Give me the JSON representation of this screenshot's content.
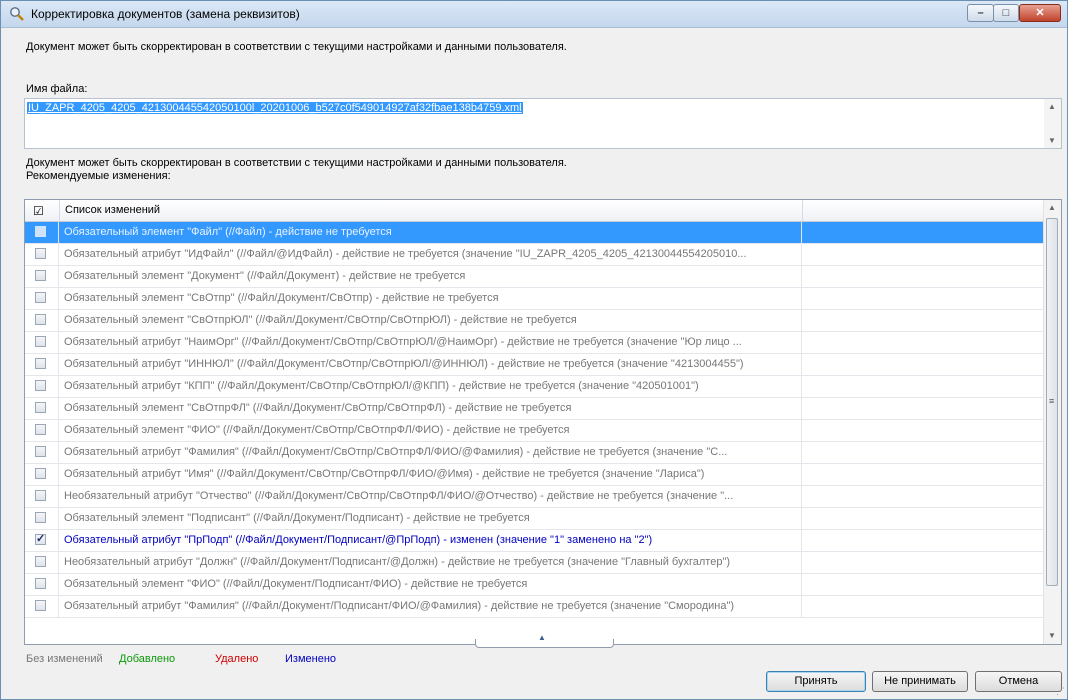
{
  "window": {
    "title": "Корректировка документов (замена реквизитов)",
    "min_label": "–",
    "max_label": "□",
    "close_label": "✕"
  },
  "info_top": "Документ может быть скорректирован в соответствии с текущими настройками и данными пользователя.",
  "file": {
    "label": "Имя файла:",
    "value": "IU_ZAPR_4205_4205_421300445542050100l_20201006_b527c0f549014927af32fbae138b4759.xml"
  },
  "info_mid": {
    "line1": "Документ может быть скорректирован в соответствии с текущими настройками и данными пользователя.",
    "line2": "Рекомендуемые изменения:"
  },
  "list": {
    "header_check": "☑",
    "header_col": "Список изменений",
    "rows": [
      {
        "text": "Обязательный элемент \"Файл\" (//Файл) - действие не требуется",
        "checked": false,
        "selected": true,
        "changed": false
      },
      {
        "text": "Обязательный атрибут \"ИдФайл\" (//Файл/@ИдФайл) - действие не требуется (значение \"IU_ZAPR_4205_4205_42130044554205010...",
        "checked": false,
        "selected": false,
        "changed": false
      },
      {
        "text": "Обязательный элемент \"Документ\" (//Файл/Документ) - действие не требуется",
        "checked": false,
        "selected": false,
        "changed": false
      },
      {
        "text": "Обязательный элемент \"СвОтпр\" (//Файл/Документ/СвОтпр) - действие не требуется",
        "checked": false,
        "selected": false,
        "changed": false
      },
      {
        "text": "Обязательный элемент \"СвОтпрЮЛ\" (//Файл/Документ/СвОтпр/СвОтпрЮЛ) - действие не требуется",
        "checked": false,
        "selected": false,
        "changed": false
      },
      {
        "text": "Обязательный атрибут \"НаимОрг\" (//Файл/Документ/СвОтпр/СвОтпрЮЛ/@НаимОрг) - действие не требуется (значение \"Юр лицо ...",
        "checked": false,
        "selected": false,
        "changed": false
      },
      {
        "text": "Обязательный атрибут \"ИННЮЛ\" (//Файл/Документ/СвОтпр/СвОтпрЮЛ/@ИННЮЛ) - действие не требуется (значение \"4213004455\")",
        "checked": false,
        "selected": false,
        "changed": false
      },
      {
        "text": "Обязательный атрибут \"КПП\" (//Файл/Документ/СвОтпр/СвОтпрЮЛ/@КПП) - действие не требуется (значение \"420501001\")",
        "checked": false,
        "selected": false,
        "changed": false
      },
      {
        "text": "Обязательный элемент \"СвОтпрФЛ\" (//Файл/Документ/СвОтпр/СвОтпрФЛ) - действие не требуется",
        "checked": false,
        "selected": false,
        "changed": false
      },
      {
        "text": "Обязательный элемент \"ФИО\" (//Файл/Документ/СвОтпр/СвОтпрФЛ/ФИО) - действие не требуется",
        "checked": false,
        "selected": false,
        "changed": false
      },
      {
        "text": "Обязательный атрибут \"Фамилия\" (//Файл/Документ/СвОтпр/СвОтпрФЛ/ФИО/@Фамилия) - действие не требуется (значение \"С...",
        "checked": false,
        "selected": false,
        "changed": false
      },
      {
        "text": "Обязательный атрибут \"Имя\" (//Файл/Документ/СвОтпр/СвОтпрФЛ/ФИО/@Имя) - действие не требуется (значение \"Лариса\")",
        "checked": false,
        "selected": false,
        "changed": false
      },
      {
        "text": "Необязательный атрибут \"Отчество\" (//Файл/Документ/СвОтпр/СвОтпрФЛ/ФИО/@Отчество) - действие не требуется (значение \"...",
        "checked": false,
        "selected": false,
        "changed": false
      },
      {
        "text": "Обязательный элемент \"Подписант\" (//Файл/Документ/Подписант) - действие не требуется",
        "checked": false,
        "selected": false,
        "changed": false
      },
      {
        "text": "Обязательный атрибут \"ПрПодп\" (//Файл/Документ/Подписант/@ПрПодп) - изменен (значение \"1\" заменено на \"2\")",
        "checked": true,
        "selected": false,
        "changed": true
      },
      {
        "text": "Необязательный атрибут \"Должн\" (//Файл/Документ/Подписант/@Должн) - действие не требуется (значение \"Главный бухгалтер\")",
        "checked": false,
        "selected": false,
        "changed": false
      },
      {
        "text": "Обязательный элемент \"ФИО\" (//Файл/Документ/Подписант/ФИО) - действие не требуется",
        "checked": false,
        "selected": false,
        "changed": false
      },
      {
        "text": "Обязательный атрибут \"Фамилия\" (//Файл/Документ/Подписант/ФИО/@Фамилия) - действие не требуется (значение \"Смородина\")",
        "checked": false,
        "selected": false,
        "changed": false
      }
    ]
  },
  "legend": {
    "unchanged": "Без изменений",
    "added": "Добавлено",
    "deleted": "Удалено",
    "changed": "Изменено"
  },
  "buttons": {
    "accept": "Принять",
    "reject": "Не принимать",
    "cancel": "Отмена"
  },
  "colors": {
    "selection": "#3399ff",
    "added": "#0a9a0a",
    "deleted": "#d00000",
    "changed": "#0000c0"
  }
}
